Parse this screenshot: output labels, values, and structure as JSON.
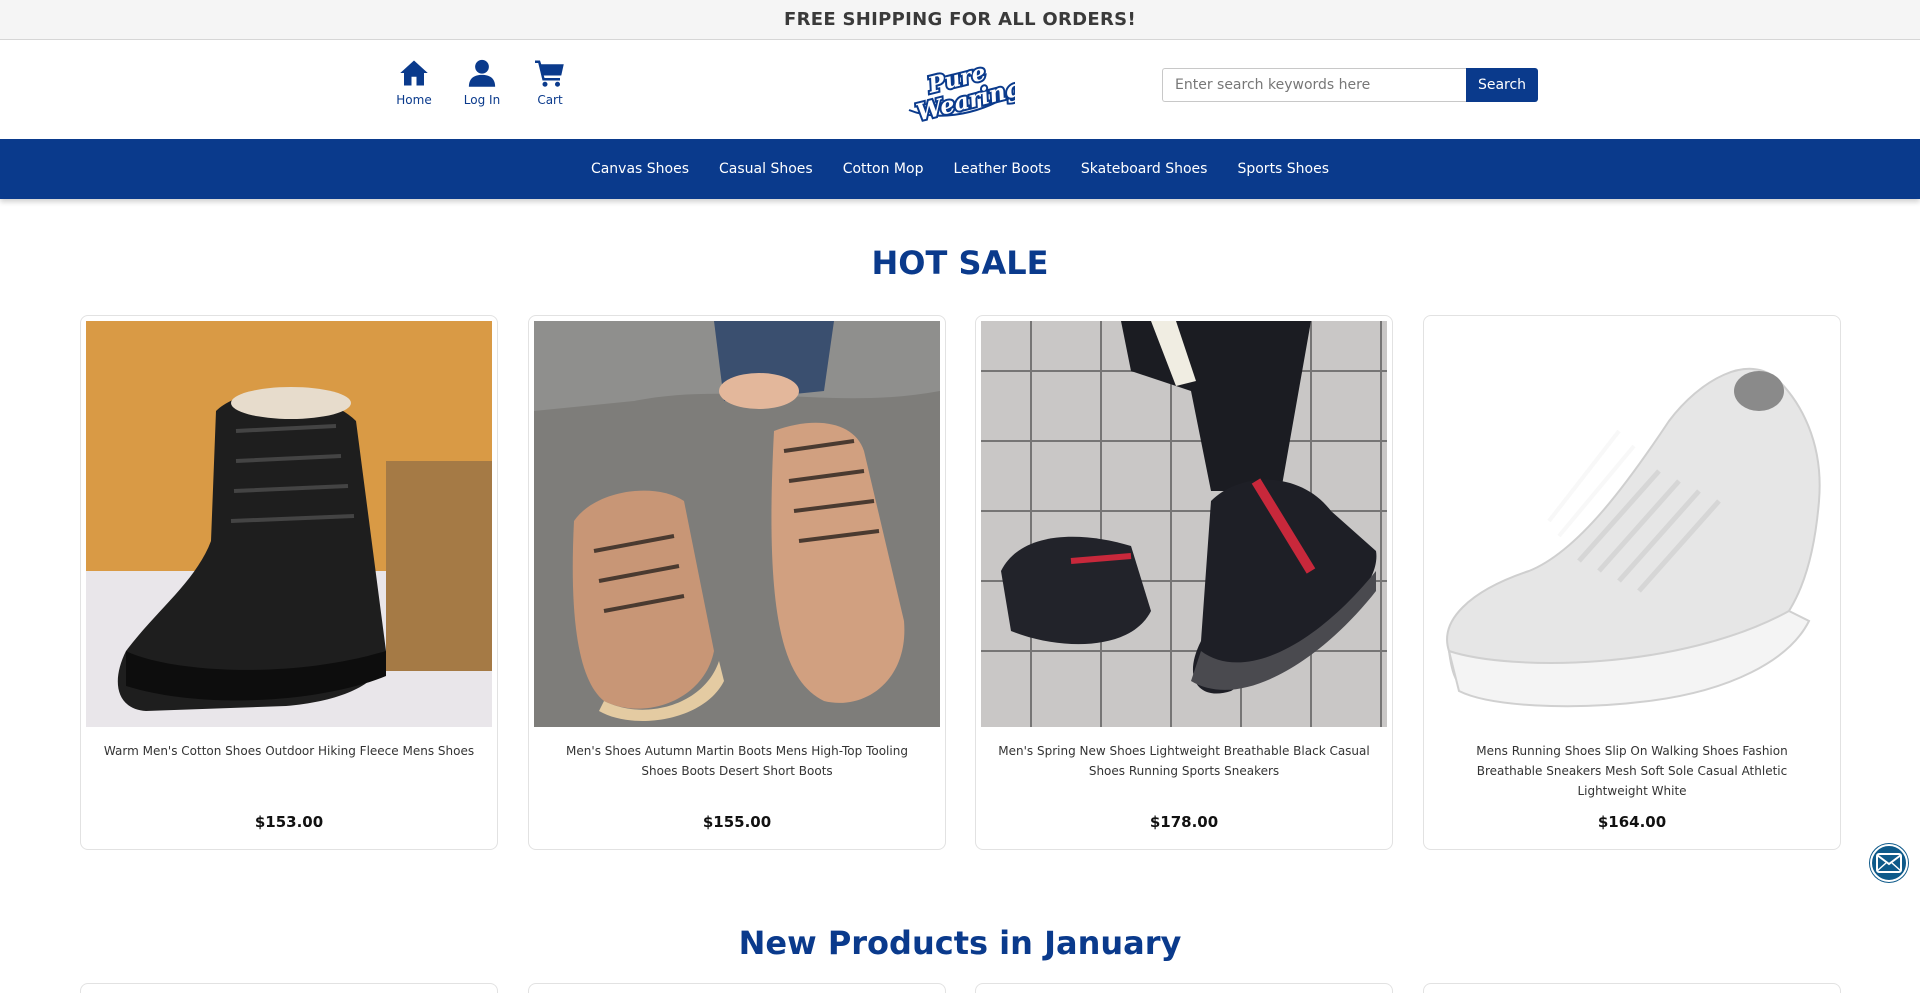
{
  "announcement": "FREE SHIPPING FOR ALL ORDERS!",
  "header_nav": {
    "home": {
      "label": "Home",
      "icon": "home-icon"
    },
    "login": {
      "label": "Log In",
      "icon": "user-icon"
    },
    "cart": {
      "label": "Cart",
      "icon": "cart-icon"
    }
  },
  "logo": {
    "line1": "Pure",
    "line2": "Wearing"
  },
  "search": {
    "placeholder": "Enter search keywords here",
    "button_label": "Search"
  },
  "categories": [
    "Canvas Shoes",
    "Casual Shoes",
    "Cotton Mop",
    "Leather Boots",
    "Skateboard Shoes",
    "Sports Shoes"
  ],
  "hot_sale": {
    "title": "HOT SALE",
    "products": [
      {
        "name": "Warm Men's Cotton Shoes Outdoor Hiking Fleece Mens Shoes",
        "price": "$153.00"
      },
      {
        "name": "Men's Shoes Autumn Martin Boots Mens High-Top Tooling Shoes Boots Desert Short Boots",
        "price": "$155.00"
      },
      {
        "name": "Men's Spring New Shoes Lightweight Breathable Black Casual Shoes Running Sports Sneakers",
        "price": "$178.00"
      },
      {
        "name": "Mens Running Shoes Slip On Walking Shoes Fashion Breathable Sneakers Mesh Soft Sole Casual Athletic Lightweight White",
        "price": "$164.00"
      }
    ]
  },
  "new_products": {
    "title": "New Products in January"
  },
  "colors": {
    "brand": "#0a3a8c",
    "topbar": "#f5f5f5",
    "mail_button": "#0e5a8a"
  }
}
